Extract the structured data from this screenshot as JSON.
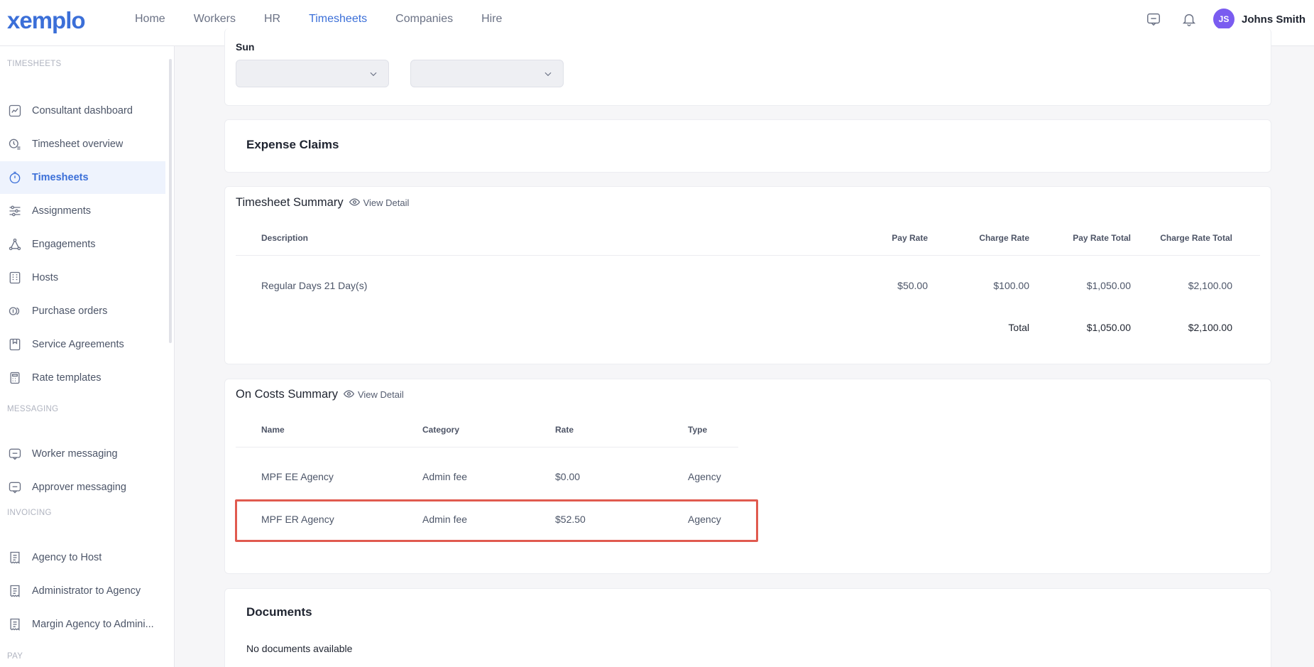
{
  "brand": "xemplo",
  "nav": [
    {
      "label": "Home",
      "active": false
    },
    {
      "label": "Workers",
      "active": false
    },
    {
      "label": "HR",
      "active": false
    },
    {
      "label": "Timesheets",
      "active": true
    },
    {
      "label": "Companies",
      "active": false
    },
    {
      "label": "Hire",
      "active": false
    }
  ],
  "user": {
    "initials": "JS",
    "name": "Johns Smith"
  },
  "sidebar": {
    "sections": {
      "timesheets": "TIMESHEETS",
      "messaging": "MESSAGING",
      "invoicing": "INVOICING",
      "pay": "PAY"
    },
    "items": [
      {
        "label": "Consultant dashboard",
        "icon": "chart-icon"
      },
      {
        "label": "Timesheet overview",
        "icon": "clock-list-icon"
      },
      {
        "label": "Timesheets",
        "icon": "stopwatch-icon"
      },
      {
        "label": "Assignments",
        "icon": "sliders-icon"
      },
      {
        "label": "Engagements",
        "icon": "network-icon"
      },
      {
        "label": "Hosts",
        "icon": "building-icon"
      },
      {
        "label": "Purchase orders",
        "icon": "coins-icon"
      },
      {
        "label": "Service Agreements",
        "icon": "bookmark-icon"
      },
      {
        "label": "Rate templates",
        "icon": "calculator-icon"
      },
      {
        "label": "Worker messaging",
        "icon": "message-icon"
      },
      {
        "label": "Approver messaging",
        "icon": "message-icon"
      },
      {
        "label": "Agency to Host",
        "icon": "receipt-icon"
      },
      {
        "label": "Administrator to Agency",
        "icon": "receipt-icon"
      },
      {
        "label": "Margin Agency to Admini...",
        "icon": "receipt-icon"
      }
    ]
  },
  "schedule": {
    "day_label": "Sun"
  },
  "expense": {
    "title": "Expense Claims"
  },
  "timesheet_summary": {
    "title": "Timesheet Summary",
    "view_detail": "View Detail",
    "headers": [
      "Description",
      "Pay Rate",
      "Charge Rate",
      "Pay Rate Total",
      "Charge Rate Total"
    ],
    "rows": [
      {
        "description": "Regular Days 21 Day(s)",
        "pay_rate": "$50.00",
        "charge_rate": "$100.00",
        "pay_rate_total": "$1,050.00",
        "charge_rate_total": "$2,100.00"
      }
    ],
    "total_label": "Total",
    "total_pay": "$1,050.00",
    "total_charge": "$2,100.00"
  },
  "oncosts_summary": {
    "title": "On Costs Summary",
    "view_detail": "View Detail",
    "headers": [
      "Name",
      "Category",
      "Rate",
      "Type"
    ],
    "rows": [
      {
        "name": "MPF EE Agency",
        "category": "Admin fee",
        "rate": "$0.00",
        "type": "Agency"
      },
      {
        "name": "MPF ER Agency",
        "category": "Admin fee",
        "rate": "$52.50",
        "type": "Agency"
      }
    ]
  },
  "documents": {
    "title": "Documents",
    "empty": "No documents available"
  },
  "colors": {
    "accent": "#3b6fd8",
    "highlight": "#e05a4f",
    "avatar": "#7a5cf0"
  }
}
